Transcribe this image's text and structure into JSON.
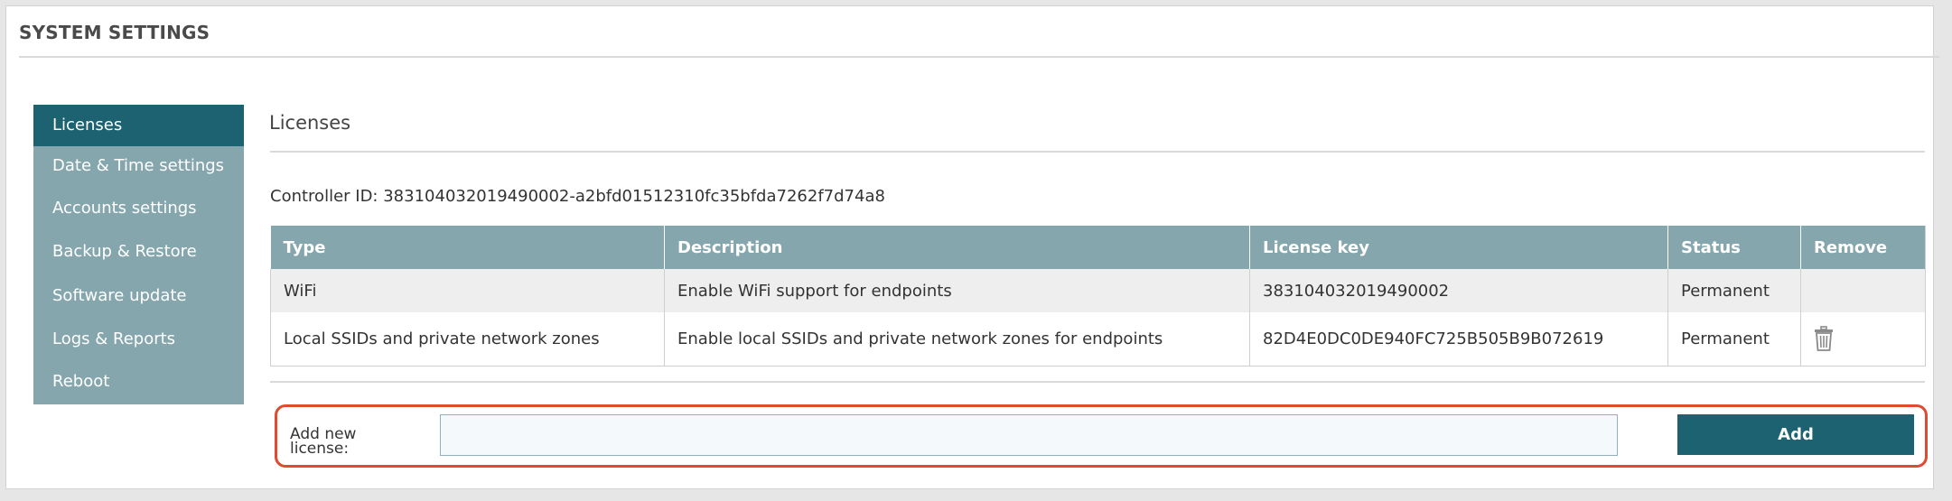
{
  "page": {
    "title": "SYSTEM SETTINGS"
  },
  "sidebar": {
    "items": [
      {
        "label": "Licenses",
        "active": true
      },
      {
        "label": "Date & Time settings",
        "active": false
      },
      {
        "label": "Accounts settings",
        "active": false
      },
      {
        "label": "Backup & Restore",
        "active": false
      },
      {
        "label": "Software update",
        "active": false
      },
      {
        "label": "Logs & Reports",
        "active": false
      },
      {
        "label": "Reboot",
        "active": false
      }
    ]
  },
  "main": {
    "title": "Licenses",
    "controller_label": "Controller ID:",
    "controller_id": "383104032019490002-a2bfd01512310fc35bfda7262f7d74a8",
    "table": {
      "headers": [
        "Type",
        "Description",
        "License key",
        "Status",
        "Remove"
      ],
      "rows": [
        {
          "type": "WiFi",
          "description": "Enable WiFi support for endpoints",
          "license_key": "383104032019490002",
          "status": "Permanent",
          "removable": false
        },
        {
          "type": "Local SSIDs and private network zones",
          "description": "Enable local SSIDs and private network zones for endpoints",
          "license_key": "82D4E0DC0DE940FC725B505B9B072619",
          "status": "Permanent",
          "removable": true,
          "remove_icon": "trash-icon"
        }
      ]
    },
    "add_license": {
      "label": "Add new license:",
      "input_value": "",
      "button_label": "Add"
    }
  },
  "colors": {
    "accent_dark": "#1c6270",
    "accent_light": "#86a6ae",
    "highlight_border": "#e04a2f"
  }
}
